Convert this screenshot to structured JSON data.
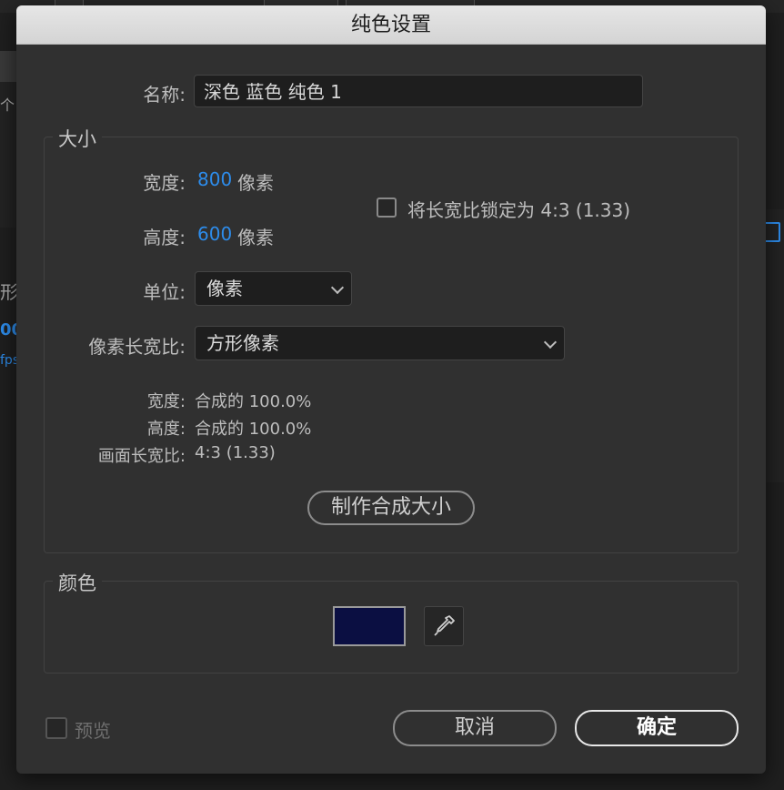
{
  "dialog": {
    "title": "纯色设置",
    "name_label": "名称:",
    "name_value": "深色 蓝色 纯色 1",
    "size_group": "大小",
    "width_label": "宽度:",
    "width_value": "800",
    "width_unit": "像素",
    "height_label": "高度:",
    "height_value": "600",
    "height_unit": "像素",
    "lock_aspect_label": "将长宽比锁定为 4:3 (1.33)",
    "unit_label": "单位:",
    "unit_value": "像素",
    "par_label": "像素长宽比:",
    "par_value": "方形像素",
    "info_width_label": "宽度:",
    "info_width_value": "合成的 100.0%",
    "info_height_label": "高度:",
    "info_height_value": "合成的 100.0%",
    "info_frame_label": "画面长宽比:",
    "info_frame_value": "4:3 (1.33)",
    "make_comp_size": "制作合成大小",
    "color_group": "颜色",
    "color_value": "#0b0f42",
    "preview_label": "预览",
    "cancel": "取消",
    "ok": "确定"
  },
  "background": {
    "left_text_1": "个",
    "left_text_2": "形",
    "left_text_3": "00",
    "left_text_4": "fps"
  },
  "colors": {
    "accent": "#2d8ceb"
  }
}
